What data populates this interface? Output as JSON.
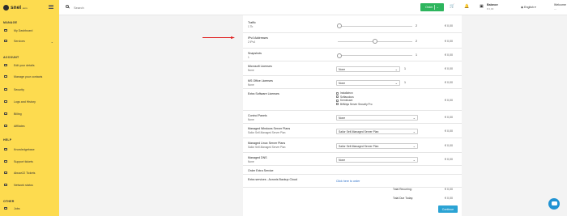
{
  "brand": {
    "name": "snel",
    "suffix": ".com"
  },
  "sidebar": {
    "sections": [
      {
        "heading": "MANAGE",
        "items": [
          {
            "label": "My Dashboard",
            "icon": "dashboard-icon"
          },
          {
            "label": "Services",
            "icon": "services-icon",
            "has_chevron": true
          }
        ]
      },
      {
        "heading": "ACCOUNT",
        "items": [
          {
            "label": "Edit your details",
            "icon": "user-edit-icon"
          },
          {
            "label": "Manage your contacts",
            "icon": "contacts-icon"
          },
          {
            "label": "Security",
            "icon": "security-icon"
          },
          {
            "label": "Logs and History",
            "icon": "history-icon"
          },
          {
            "label": "Billing",
            "icon": "billing-icon"
          },
          {
            "label": "Affiliates",
            "icon": "affiliates-icon"
          }
        ]
      },
      {
        "heading": "HELP",
        "items": [
          {
            "label": "Knowledgebase",
            "icon": "knowledgebase-icon"
          },
          {
            "label": "Support tickets",
            "icon": "tickets-icon"
          },
          {
            "label": "Abuse22 Tickets",
            "icon": "abuse-icon"
          },
          {
            "label": "Network status",
            "icon": "network-icon"
          }
        ]
      },
      {
        "heading": "OTHER",
        "items": [
          {
            "label": "Jobs",
            "icon": "jobs-icon"
          }
        ]
      }
    ]
  },
  "topbar": {
    "search_placeholder": "Search",
    "order_label": "Order",
    "balance_label": "Balance",
    "balance_value": "€ 0,00",
    "language": "English",
    "welcome": "Welcome",
    "welcome_sub": "—"
  },
  "config": {
    "rows": [
      {
        "label": "Traffic",
        "sub": "1 Tb",
        "type": "slider",
        "value": "2",
        "price": "€ 0,00",
        "level": 0.02
      },
      {
        "label": "IPv4 Addresses",
        "sub": "2 IPv4",
        "type": "slider",
        "value": "2",
        "price": "€ 0,00",
        "level": 0.5
      },
      {
        "label": "Snapshots",
        "sub": "1",
        "type": "slider",
        "value": "1",
        "price": "€ 0,00",
        "level": 0.02
      },
      {
        "label": "Microsoft Licenses",
        "sub": "None",
        "type": "select-qty",
        "value": "None",
        "qty": "1",
        "price": "€ 0,00"
      },
      {
        "label": "MS Office Licenses",
        "sub": "None",
        "type": "select-qty",
        "value": "None",
        "qty": "1",
        "price": "€ 0,00"
      },
      {
        "label": "Extra Software Licenses",
        "sub": "",
        "type": "checkboxes",
        "options": [
          "Installatron",
          "Softaculous",
          "Kernelcare",
          "BitNinja Server Security Pro"
        ],
        "price": "€ 0,00"
      },
      {
        "label": "Control Panels",
        "sub": "None",
        "type": "select",
        "value": "None",
        "price": "€ 0,00"
      },
      {
        "label": "Managed Windows Server Plans",
        "sub": "Sailor Self-Managed Server Plan",
        "type": "select",
        "value": "Sailor Self-Managed Server Plan",
        "price": "€ 0,00"
      },
      {
        "label": "Managed Linux Server Plans",
        "sub": "Sailor Self-Managed Server Plan",
        "type": "select",
        "value": "Sailor Self-Managed Server Plan",
        "price": "€ 0,00"
      },
      {
        "label": "Managed DNS",
        "sub": "None",
        "type": "select",
        "value": "None",
        "price": "€ 0,00"
      },
      {
        "label": "Order Extra Service",
        "sub": "",
        "type": "none",
        "price": ""
      },
      {
        "label": "Extra services - Acronis Backup Cloud",
        "sub": "",
        "type": "link",
        "value": "Click here to order",
        "price": ""
      }
    ],
    "total_recurring_label": "Total Recurring:",
    "total_recurring_value": "€ 0,00",
    "total_due_label": "Total Due Today:",
    "total_due_value": "€ 0,00",
    "continue_label": "Continue"
  },
  "colors": {
    "sidebar": "#fddb4f",
    "accent_green": "#2db55d",
    "accent_blue": "#2ba3d4",
    "arrow": "#e02020"
  }
}
